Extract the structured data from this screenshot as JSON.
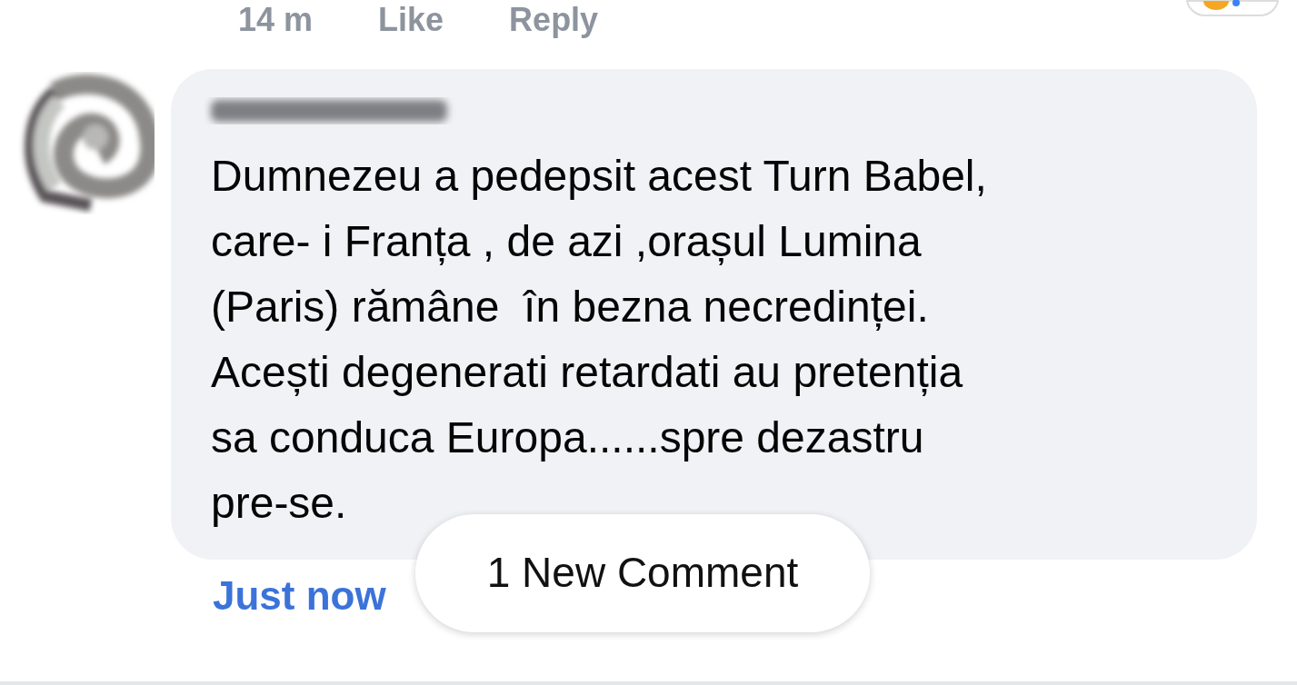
{
  "previous_comment_actions": {
    "time": "14 m",
    "like": "Like",
    "reply": "Reply"
  },
  "comment": {
    "text": "Dumnezeu a pedepsit acest Turn Babel,\ncare- i Franța , de azi ,orașul Lumina\n(Paris) rămâne  în bezna necredinței.\nAcești degenerati retardati au pretenția\nsa conduca Europa......spre dezastru\npre-se.",
    "time": "Just now"
  },
  "new_comments_pill": {
    "label": "1 New Comment"
  }
}
